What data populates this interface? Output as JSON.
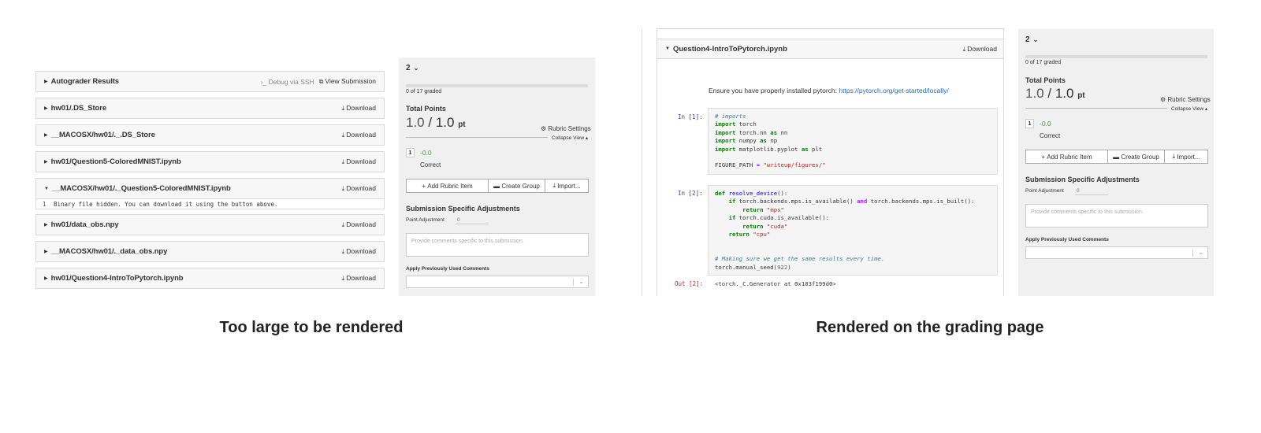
{
  "left": {
    "files": [
      {
        "name": "Autograder Results",
        "debug": "›_ Debug via SSH",
        "action": "View Submission",
        "expanded": false
      },
      {
        "name": "hw01/.DS_Store",
        "action": "Download",
        "expanded": false
      },
      {
        "name": "__MACOSX/hw01/._.DS_Store",
        "action": "Download",
        "expanded": false
      },
      {
        "name": "hw01/Question5-ColoredMNIST.ipynb",
        "action": "Download",
        "expanded": false
      },
      {
        "name": "__MACOSX/hw01/._Question5-ColoredMNIST.ipynb",
        "action": "Download",
        "expanded": true
      },
      {
        "name": "hw01/data_obs.npy",
        "action": "Download",
        "expanded": false
      },
      {
        "name": "__MACOSX/hw01/._data_obs.npy",
        "action": "Download",
        "expanded": false
      },
      {
        "name": "hw01/Question4-IntroToPytorch.ipynb",
        "action": "Download",
        "expanded": false
      }
    ],
    "binary_line_no": "1",
    "binary_message": "Binary file hidden. You can download it using the button above."
  },
  "sidebar": {
    "question": "2",
    "graded": "0 of 17 graded",
    "total_label": "Total Points",
    "score": "1.0",
    "score_sep": " / ",
    "score_max": "1.0",
    "score_unit": "pt",
    "rubric_settings": "Rubric Settings",
    "collapse_view": "Collapse View",
    "rubric_item_num": "1",
    "rubric_item_value": "-0.0",
    "rubric_item_desc": "Correct",
    "btn_add": "Add Rubric Item",
    "btn_group": "Create Group",
    "btn_import": "Import...",
    "adjust_title": "Submission Specific Adjustments",
    "point_adjustment_label": "Point Adjustment",
    "point_adjustment_placeholder": "0",
    "comment_placeholder": "Provide comments specific to this submission.",
    "prev_comments_label": "Apply Previously Used Comments"
  },
  "notebook": {
    "file_name": "Question4-IntroToPytorch.ipynb",
    "download": "Download",
    "md_text": "Ensure you have properly installed pytorch: ",
    "md_link": "https://pytorch.org/get-started/locally/",
    "in1_prompt": "In [1]:",
    "in2_prompt": "In [2]:",
    "out2_prompt": "Out [2]:",
    "out2_text": "<torch._C.Generator at 0x103f199d0>"
  },
  "captions": {
    "left": "Too large to be rendered",
    "right": "Rendered on the grading page"
  },
  "colors": {
    "sidebar_bg": "#f0f0f0",
    "correct_green": "#3c9c3c",
    "link_blue": "#2a6ebb",
    "in_prompt": "#303f9f",
    "out_prompt": "#c62828"
  }
}
